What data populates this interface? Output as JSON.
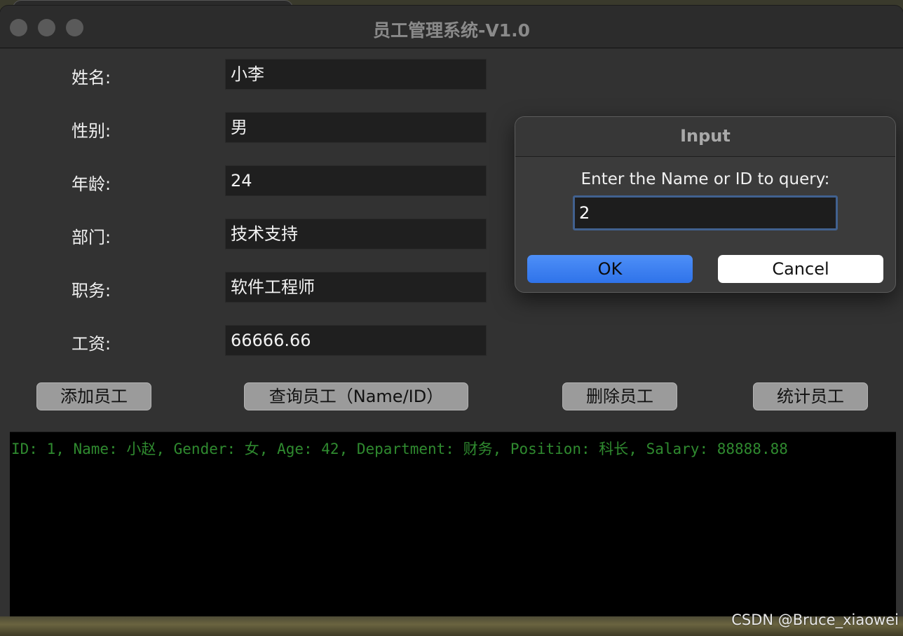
{
  "window": {
    "title": "员工管理系统-V1.0"
  },
  "form": {
    "fields": [
      {
        "label": "姓名:",
        "value": "小李"
      },
      {
        "label": "性别:",
        "value": "男"
      },
      {
        "label": "年龄:",
        "value": "24"
      },
      {
        "label": "部门:",
        "value": "技术支持"
      },
      {
        "label": "职务:",
        "value": "软件工程师"
      },
      {
        "label": "工资:",
        "value": "66666.66"
      }
    ]
  },
  "actions": {
    "add": "添加员工",
    "query": "查询员工（Name/ID）",
    "delete": "删除员工",
    "stats": "统计员工"
  },
  "console": {
    "lines": [
      "ID: 1, Name: 小赵, Gender: 女, Age: 42, Department: 财务, Position: 科长, Salary: 88888.88"
    ]
  },
  "dialog": {
    "title": "Input",
    "prompt": "Enter the Name or ID to query:",
    "input_value": "2",
    "ok_label": "OK",
    "cancel_label": "Cancel"
  },
  "watermark": "CSDN @Bruce_xiaowei",
  "colors": {
    "window_bg": "#323232",
    "console_text": "#2f8a2f",
    "ok_button": "#3b82f6",
    "focus_ring": "#41618f"
  }
}
